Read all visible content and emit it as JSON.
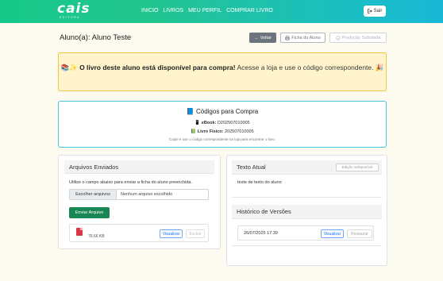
{
  "navbar": {
    "logo": "cais",
    "logo_sub": "EDITORA",
    "links": [
      "INICIO",
      "LIVROS",
      "MEU PERFIL",
      "COMPRAR LIVRO"
    ],
    "logout": "Sair"
  },
  "header": {
    "title": "Aluno(a): Aluno Teste",
    "back": "Voltar",
    "ficha": "Ficha do Aluno",
    "producao": "Produção Solicitada"
  },
  "alert": {
    "bold": "O livro deste aluno está disponível para compra!",
    "text": "Acesse a loja e use o código correspondente."
  },
  "codes": {
    "title": "Códigos para Compra",
    "ebook_label": "eBook:",
    "ebook_code": "D202507010005",
    "fisico_label": "Livro Físico:",
    "fisico_code": "202507010005",
    "hint": "Copie e use o código correspondente na loja para encontrar o livro."
  },
  "arquivos": {
    "title": "Arquivos Enviados",
    "instructions": "Utilize o campo abaixo para enviar a ficha do aluno preenchida.",
    "choose": "Escolher arquivos",
    "none": "Nenhum arquivo escolhido",
    "send": "Enviar Arquivo",
    "file_size": "76.66 KB",
    "view": "Visualizar",
    "delete": "Excluir"
  },
  "texto": {
    "title": "Texto Atual",
    "edit": "Edição indisponível",
    "content": "teste de texto do aluno"
  },
  "historico": {
    "title": "Histórico de Versões",
    "date": "26/07/2025 17:39",
    "view": "Visualizar",
    "restore": "Restaurar"
  }
}
